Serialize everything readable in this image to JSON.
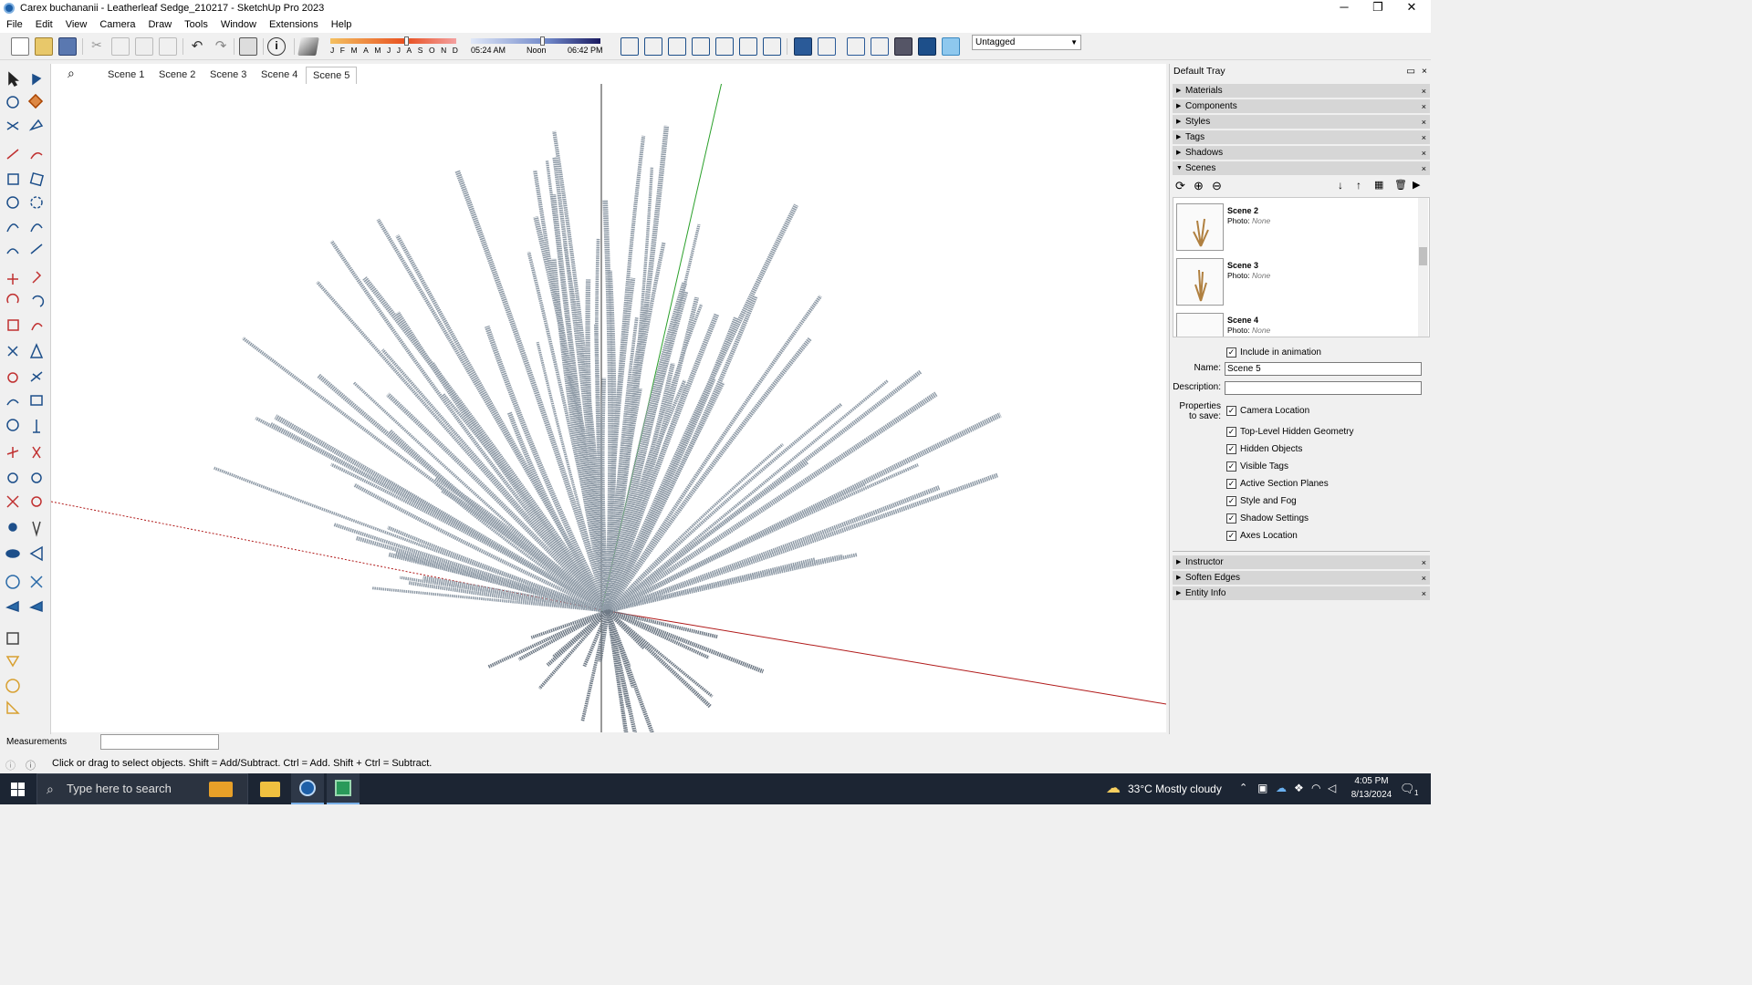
{
  "window": {
    "title": "Carex buchananii - Leatherleaf Sedge_210217 - SketchUp Pro 2023",
    "minimize_glyph": "─",
    "maximize_glyph": "❐",
    "close_glyph": "✕"
  },
  "menu": [
    "File",
    "Edit",
    "View",
    "Camera",
    "Draw",
    "Tools",
    "Window",
    "Extensions",
    "Help"
  ],
  "shadows": {
    "months": [
      "J",
      "F",
      "M",
      "A",
      "M",
      "J",
      "J",
      "A",
      "S",
      "O",
      "N",
      "D"
    ],
    "date_level": 0.6,
    "time_start": "05:24 AM",
    "time_mid": "Noon",
    "time_end": "06:42 PM",
    "time_level": 0.55
  },
  "tag_dropdown": {
    "value": "Untagged"
  },
  "scene_tabs": [
    "Scene 1",
    "Scene 2",
    "Scene 3",
    "Scene 4",
    "Scene 5"
  ],
  "active_scene_tab": "Scene 5",
  "tray": {
    "title": "Default Tray",
    "panels_top": [
      "Materials",
      "Components",
      "Styles",
      "Tags",
      "Shadows",
      "Scenes"
    ],
    "panels_bottom": [
      "Instructor",
      "Soften Edges",
      "Entity Info"
    ],
    "close_glyph": "×",
    "collapsed_glyph": "▶",
    "expanded_glyph": "▼"
  },
  "scenes_panel": {
    "list": [
      {
        "name": "Scene 2",
        "photo_label": "Photo:",
        "photo_value": "None"
      },
      {
        "name": "Scene 3",
        "photo_label": "Photo:",
        "photo_value": "None"
      },
      {
        "name": "Scene 4",
        "photo_label": "Photo:",
        "photo_value": "None"
      }
    ],
    "include_in_animation": "Include in animation",
    "name_label": "Name:",
    "name_value": "Scene 5",
    "description_label": "Description:",
    "description_value": "",
    "properties_label_1": "Properties",
    "properties_label_2": "to save:",
    "properties": [
      "Camera Location",
      "Top-Level Hidden Geometry",
      "Hidden Objects",
      "Visible Tags",
      "Active Section Planes",
      "Style and Fog",
      "Shadow Settings",
      "Axes Location"
    ],
    "check_glyph": "✓"
  },
  "measurements": {
    "label": "Measurements",
    "value": ""
  },
  "status": {
    "text": "Click or drag to select objects. Shift = Add/Subtract. Ctrl = Add. Shift + Ctrl = Subtract."
  },
  "taskbar": {
    "search_placeholder": "Type here to search",
    "weather": "33°C  Mostly cloudy",
    "time": "4:05 PM",
    "date": "8/13/2024",
    "badge": "1"
  },
  "colors": {
    "accent": "#1d5fa8",
    "axis_red": "#b01818",
    "axis_green": "#2aa02a",
    "axis_blue": "#1a1ad0",
    "leaf": "#8e9aa6"
  }
}
